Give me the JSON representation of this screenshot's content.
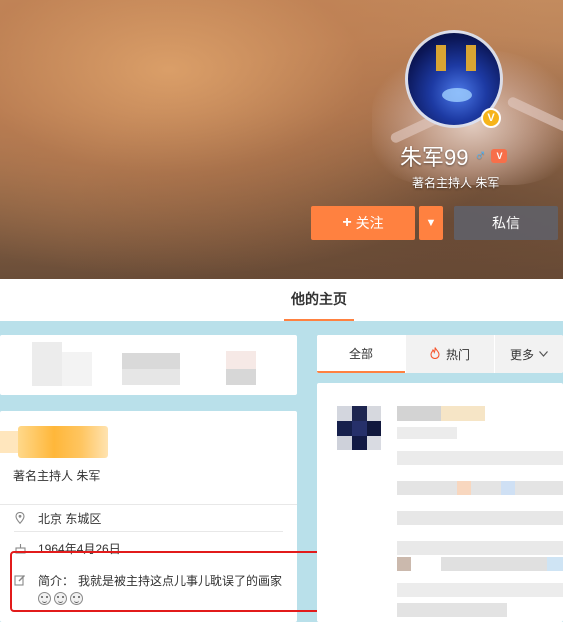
{
  "profile": {
    "name": "朱军99",
    "gender_icon": "male-icon",
    "verified_badge": "V",
    "member_badge": "vip-member-icon",
    "verify_description": "著名主持人 朱军"
  },
  "actions": {
    "follow_label": "关注",
    "follow_icon": "+",
    "follow_menu_icon": "chevron-down-icon",
    "message_label": "私信"
  },
  "nav": {
    "tab_home": "他的主页"
  },
  "info_card": {
    "description": "著名主持人 朱军",
    "location": "北京 东城区",
    "birthday": "1964年4月26日",
    "bio_label": "简介：",
    "bio_text": "我就是被主持这点儿事儿耽误了的画家",
    "bio_emojis": [
      "emoji-face",
      "emoji-face",
      "emoji-face"
    ]
  },
  "feed_tabs": {
    "all": "全部",
    "hot": "热门",
    "more": "更多"
  },
  "colors": {
    "accent": "#ff8140",
    "page_bg": "#b9e0ea",
    "highlight": "#e21b1b",
    "verified": "#f6b41a"
  }
}
